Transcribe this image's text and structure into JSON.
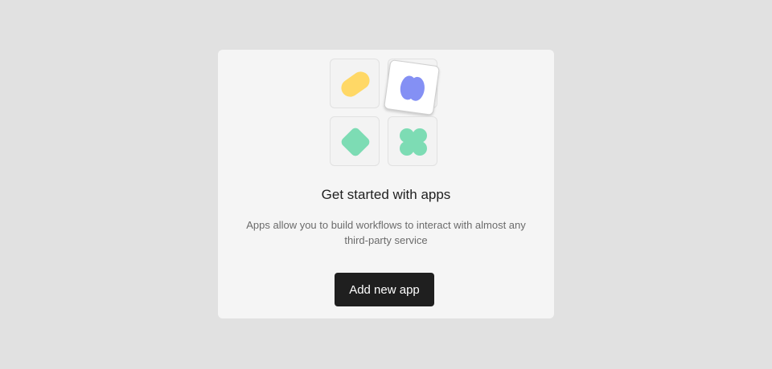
{
  "empty_state": {
    "title": "Get started with apps",
    "description": "Apps allow you to build workflows to interact with almost any third-party service",
    "button_label": "Add new app"
  },
  "illustration": {
    "tiles": [
      {
        "icon": "yellow-blob-icon",
        "color": "#ffd866"
      },
      {
        "icon": "blue-blob-icon",
        "color": "#8490f4"
      },
      {
        "icon": "green-diamond-icon",
        "color": "#7ddcb4"
      },
      {
        "icon": "green-clover-icon",
        "color": "#7ddcb4"
      }
    ]
  },
  "colors": {
    "background": "#e1e1e1",
    "card": "#f5f5f5",
    "button": "#1f1f1f",
    "button_text": "#ffffff"
  }
}
